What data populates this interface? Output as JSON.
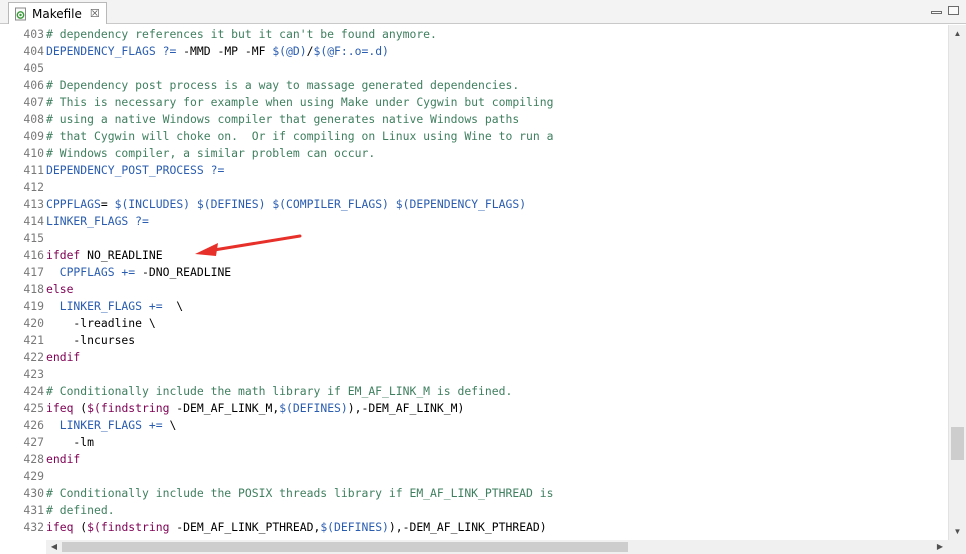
{
  "tab": {
    "title": "Makefile",
    "close_glyph": "☒",
    "icon": "makefile-file-icon"
  },
  "editor": {
    "lines": [
      {
        "n": "403",
        "segments": [
          {
            "t": "# dependency references it but it can't be found anymore.",
            "c": "cmt"
          }
        ]
      },
      {
        "n": "404",
        "segments": [
          {
            "t": "DEPENDENCY_FLAGS ?=",
            "c": "var"
          },
          {
            "t": " -MMD -MP -MF ",
            "c": "plain"
          },
          {
            "t": "$(@D)",
            "c": "var"
          },
          {
            "t": "/",
            "c": "plain"
          },
          {
            "t": "$(@F:.o=.d)",
            "c": "var"
          }
        ]
      },
      {
        "n": "405",
        "segments": []
      },
      {
        "n": "406",
        "segments": [
          {
            "t": "# Dependency post process is a way to massage generated dependencies.",
            "c": "cmt"
          }
        ]
      },
      {
        "n": "407",
        "segments": [
          {
            "t": "# This is necessary for example when using Make under Cygwin but compiling",
            "c": "cmt"
          }
        ]
      },
      {
        "n": "408",
        "segments": [
          {
            "t": "# using a native Windows compiler that generates native Windows paths",
            "c": "cmt"
          }
        ]
      },
      {
        "n": "409",
        "segments": [
          {
            "t": "# that Cygwin will choke on.  Or if compiling on Linux using Wine to run a",
            "c": "cmt"
          }
        ]
      },
      {
        "n": "410",
        "segments": [
          {
            "t": "# Windows compiler, a similar problem can occur.",
            "c": "cmt"
          }
        ]
      },
      {
        "n": "411",
        "segments": [
          {
            "t": "DEPENDENCY_POST_PROCESS ?=",
            "c": "var"
          }
        ]
      },
      {
        "n": "412",
        "segments": []
      },
      {
        "n": "413",
        "segments": [
          {
            "t": "CPPFLAGS",
            "c": "var"
          },
          {
            "t": "= ",
            "c": "plain"
          },
          {
            "t": "$(INCLUDES) $(DEFINES) $(COMPILER_FLAGS) $(DEPENDENCY_FLAGS)",
            "c": "var"
          }
        ]
      },
      {
        "n": "414",
        "segments": [
          {
            "t": "LINKER_FLAGS ?=",
            "c": "var"
          }
        ]
      },
      {
        "n": "415",
        "segments": []
      },
      {
        "n": "416",
        "segments": [
          {
            "t": "ifdef",
            "c": "kw"
          },
          {
            "t": " NO_READLINE",
            "c": "plain"
          }
        ]
      },
      {
        "n": "417",
        "segments": [
          {
            "t": "  CPPFLAGS +=",
            "c": "var"
          },
          {
            "t": " -DNO_READLINE",
            "c": "plain"
          }
        ]
      },
      {
        "n": "418",
        "segments": [
          {
            "t": "else",
            "c": "kw"
          }
        ]
      },
      {
        "n": "419",
        "segments": [
          {
            "t": "  LINKER_FLAGS +=",
            "c": "var"
          },
          {
            "t": "  \\",
            "c": "plain"
          }
        ]
      },
      {
        "n": "420",
        "segments": [
          {
            "t": "    -lreadline \\",
            "c": "plain"
          }
        ]
      },
      {
        "n": "421",
        "segments": [
          {
            "t": "    -lncurses",
            "c": "plain"
          }
        ]
      },
      {
        "n": "422",
        "segments": [
          {
            "t": "endif",
            "c": "kw"
          }
        ]
      },
      {
        "n": "423",
        "segments": []
      },
      {
        "n": "424",
        "segments": [
          {
            "t": "# Conditionally include the math library if EM_AF_LINK_M is defined.",
            "c": "cmt"
          }
        ]
      },
      {
        "n": "425",
        "segments": [
          {
            "t": "ifeq",
            "c": "kw"
          },
          {
            "t": " (",
            "c": "plain"
          },
          {
            "t": "$(findstring",
            "c": "kw"
          },
          {
            "t": " -DEM_AF_LINK_M,",
            "c": "plain"
          },
          {
            "t": "$(DEFINES)",
            "c": "var"
          },
          {
            "t": "),-DEM_AF_LINK_M)",
            "c": "plain"
          }
        ]
      },
      {
        "n": "426",
        "segments": [
          {
            "t": "  LINKER_FLAGS +=",
            "c": "var"
          },
          {
            "t": " \\",
            "c": "plain"
          }
        ]
      },
      {
        "n": "427",
        "segments": [
          {
            "t": "    -lm",
            "c": "plain"
          }
        ]
      },
      {
        "n": "428",
        "segments": [
          {
            "t": "endif",
            "c": "kw"
          }
        ]
      },
      {
        "n": "429",
        "segments": []
      },
      {
        "n": "430",
        "segments": [
          {
            "t": "# Conditionally include the POSIX threads library if EM_AF_LINK_PTHREAD is",
            "c": "cmt"
          }
        ]
      },
      {
        "n": "431",
        "segments": [
          {
            "t": "# defined.",
            "c": "cmt"
          }
        ]
      },
      {
        "n": "432",
        "segments": [
          {
            "t": "ifeq",
            "c": "kw"
          },
          {
            "t": " (",
            "c": "plain"
          },
          {
            "t": "$(findstring",
            "c": "kw"
          },
          {
            "t": " -DEM_AF_LINK_PTHREAD,",
            "c": "plain"
          },
          {
            "t": "$(DEFINES)",
            "c": "var"
          },
          {
            "t": "),-DEM_AF_LINK_PTHREAD)",
            "c": "plain"
          }
        ]
      }
    ]
  },
  "scroll": {
    "vertical_position": 0.86,
    "vertical_visible_fraction": 0.07,
    "horizontal_position": 0.0,
    "horizontal_visible_fraction": 0.65
  },
  "annotation": {
    "type": "arrow",
    "color": "#e8302a",
    "points_to_line": "416"
  },
  "colors": {
    "comment": "#3f7f5f",
    "variable": "#2a5db0",
    "keyword": "#7f0055",
    "line_number": "#787878"
  }
}
